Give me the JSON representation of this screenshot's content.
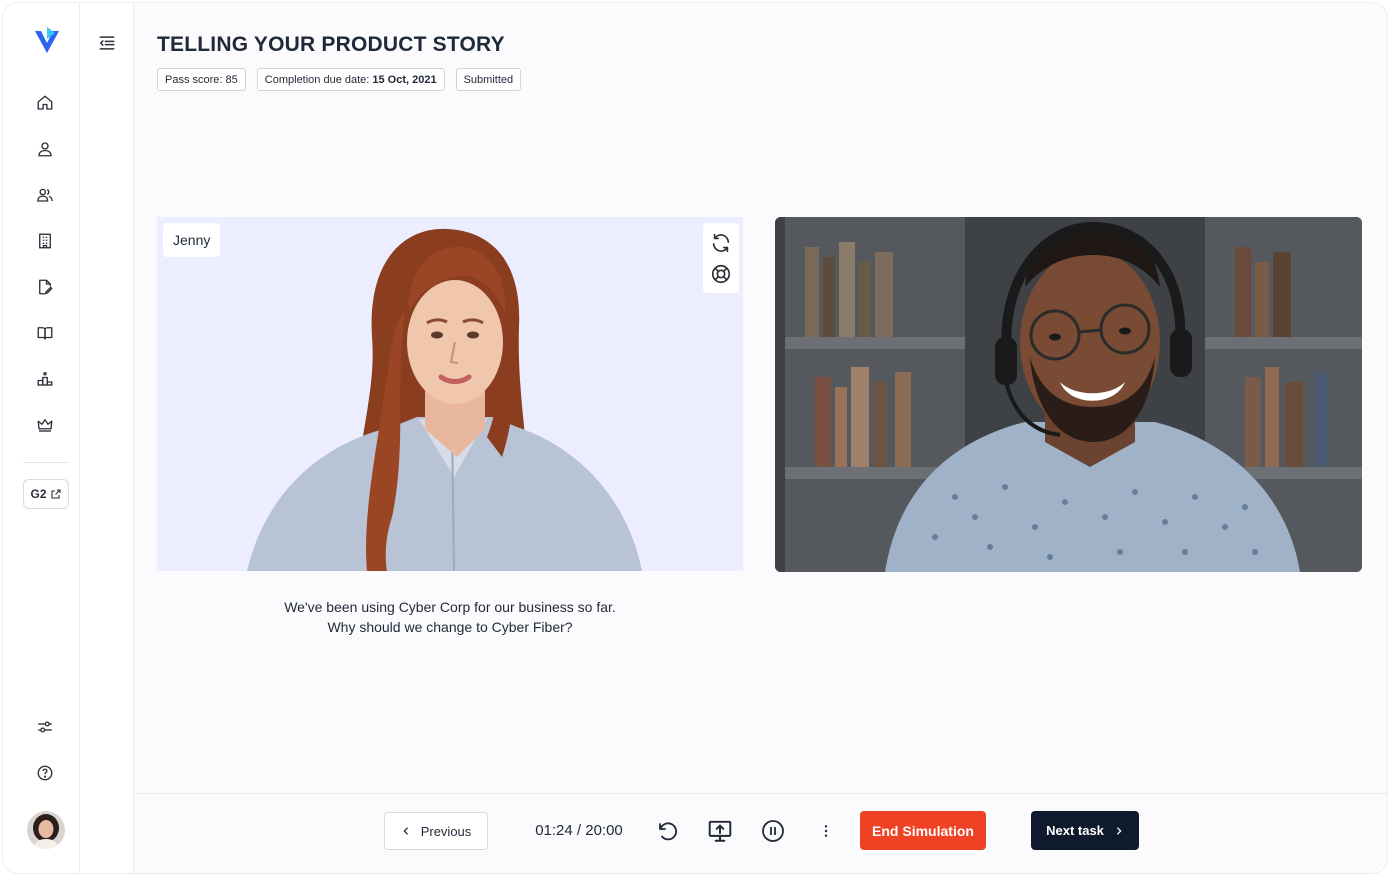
{
  "sidebar": {
    "items": [
      {
        "name": "home",
        "icon": "home-icon"
      },
      {
        "name": "profile",
        "icon": "user-icon"
      },
      {
        "name": "teams",
        "icon": "users-icon"
      },
      {
        "name": "organization",
        "icon": "building-icon"
      },
      {
        "name": "documents",
        "icon": "file-edit-icon"
      },
      {
        "name": "library",
        "icon": "book-open-icon"
      },
      {
        "name": "leaderboard",
        "icon": "podium-icon"
      },
      {
        "name": "achievements",
        "icon": "crown-icon"
      }
    ],
    "g2_label": "G2",
    "bottom_items": [
      {
        "name": "settings",
        "icon": "sliders-icon"
      },
      {
        "name": "help",
        "icon": "help-circle-icon"
      }
    ]
  },
  "header": {
    "title": "TELLING YOUR PRODUCT STORY",
    "pass_score_label": "Pass score:",
    "pass_score": "85",
    "due_label": "Completion due date:",
    "due_date": "15 Oct, 2021",
    "status": "Submitted"
  },
  "simulation": {
    "persona_name": "Jenny",
    "caption_line1": "We've been using Cyber Corp for our business so far.",
    "caption_line2": "Why should we change to Cyber Fiber?"
  },
  "controls": {
    "previous_label": "Previous",
    "timer": "01:24 / 20:00",
    "end_label": "End Simulation",
    "next_label": "Next task"
  },
  "colors": {
    "brand": "#2563eb",
    "end_button": "#ef4123",
    "next_button": "#0f1b2d"
  }
}
